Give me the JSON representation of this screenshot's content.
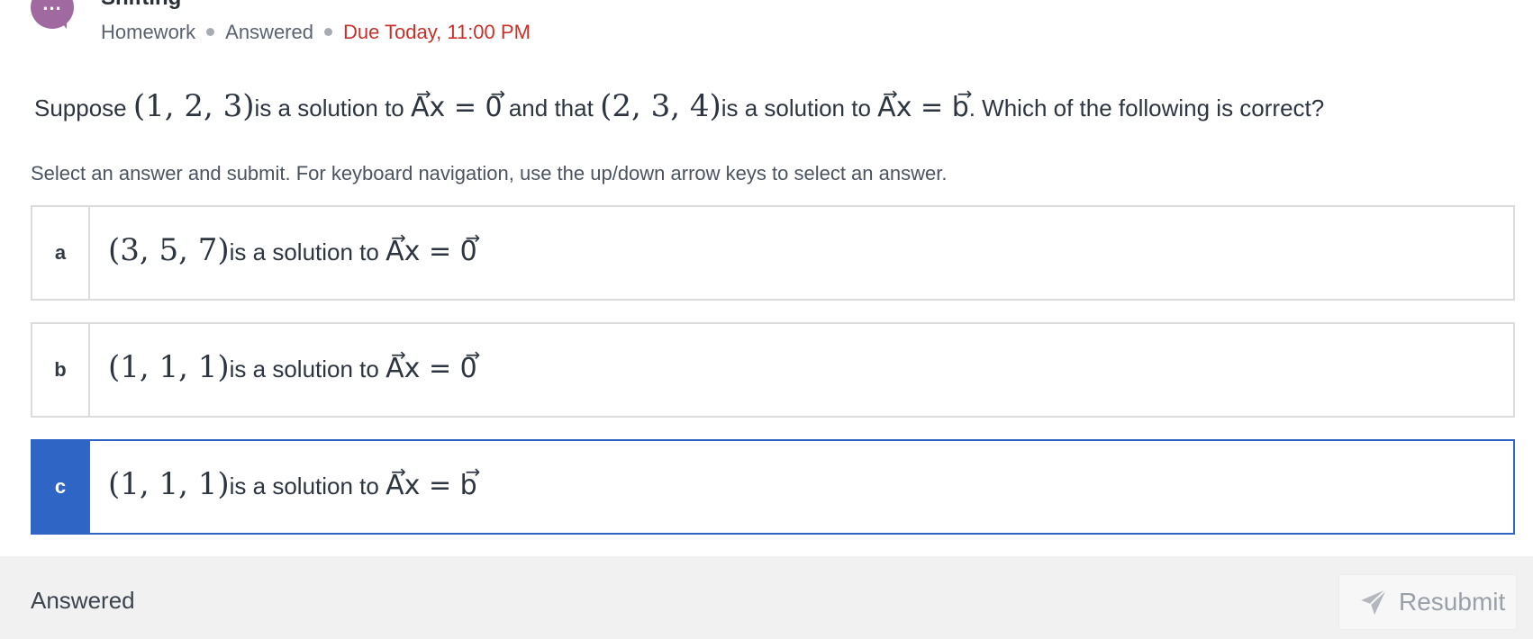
{
  "header": {
    "badge_text": "...",
    "title": "Shifting",
    "type": "Homework",
    "status": "Answered",
    "due": "Due Today, 11:00 PM"
  },
  "question": {
    "t1": "Suppose",
    "m1": "(1, 2, 3)",
    "t2": "is a solution to",
    "eq1_lhs": "Ax",
    "eq1_op": "=",
    "eq1_rhs": "0",
    "t3": "and that",
    "m2": "(2, 3, 4)",
    "t4": "is a solution to",
    "eq2_lhs": "Ax",
    "eq2_op": "=",
    "eq2_rhs": "b",
    "t5": ". Which of the following is correct?"
  },
  "instructions": "Select an answer and submit. For keyboard navigation, use the up/down arrow keys to select an answer.",
  "options": [
    {
      "letter": "a",
      "tuple": "(3, 5, 7)",
      "text": "is a solution to",
      "lhs": "Ax",
      "op": "=",
      "rhs": "0",
      "selected": false
    },
    {
      "letter": "b",
      "tuple": "(1, 1, 1)",
      "text": "is a solution to",
      "lhs": "Ax",
      "op": "=",
      "rhs": "0",
      "selected": false
    },
    {
      "letter": "c",
      "tuple": "(1, 1, 1)",
      "text": "is a solution to",
      "lhs": "Ax",
      "op": "=",
      "rhs": "b",
      "selected": true
    }
  ],
  "footer": {
    "status": "Answered",
    "resubmit_label": "Resubmit",
    "resubmit_icon": "send-icon"
  },
  "colors": {
    "accent": "#2f65c5",
    "due": "#c8312b",
    "badge": "#a06aa0"
  }
}
